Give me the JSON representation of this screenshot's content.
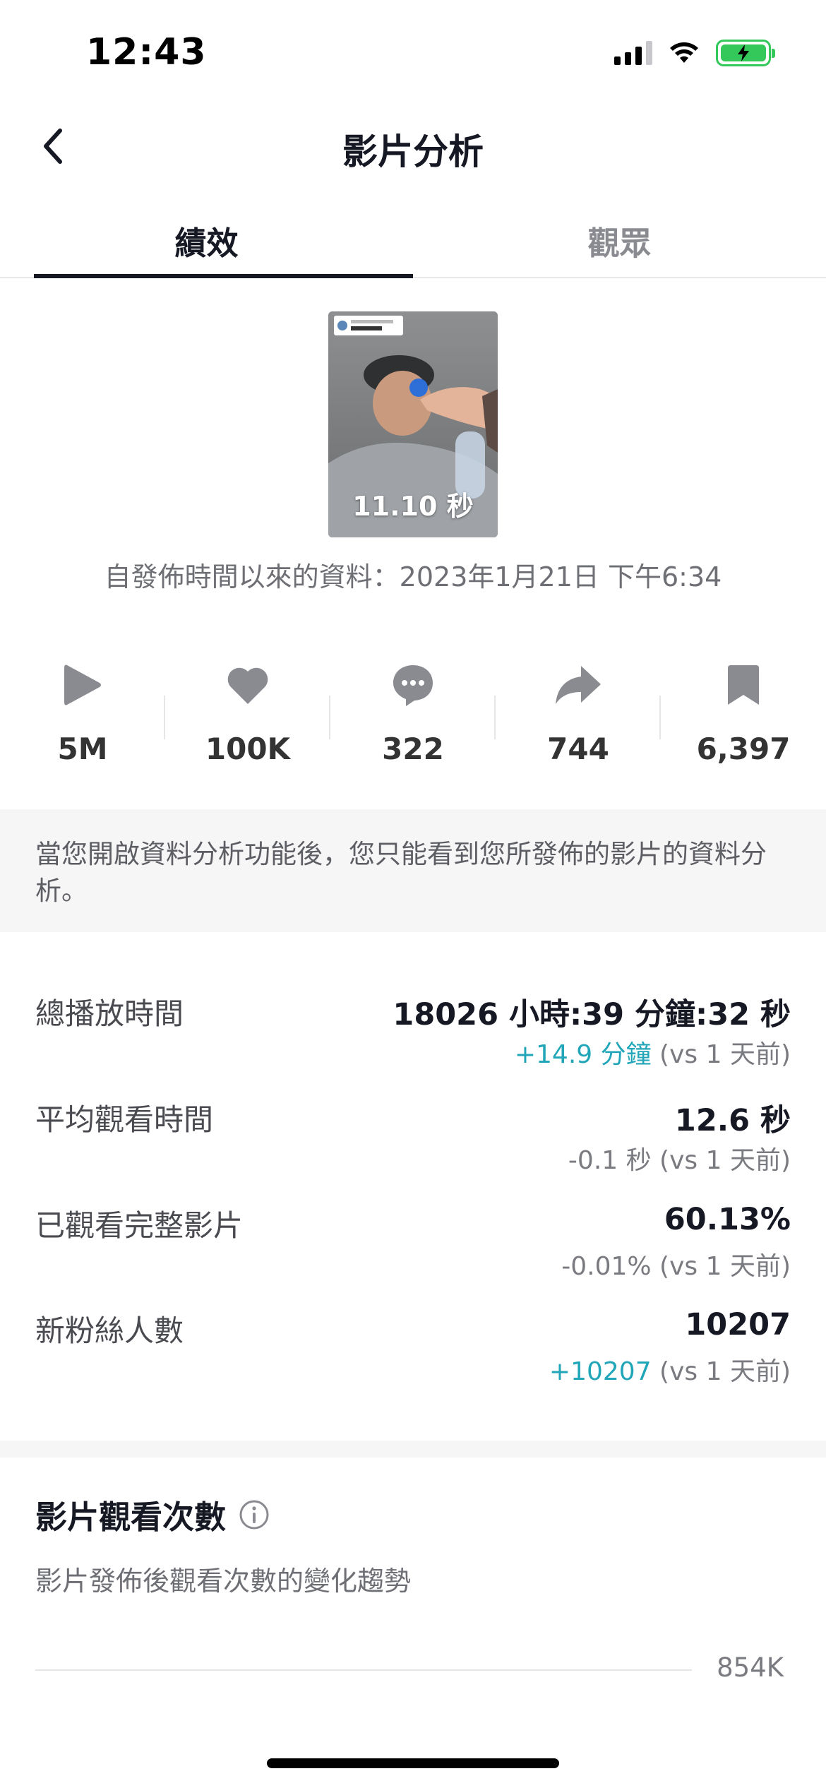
{
  "status_bar": {
    "time": "12:43",
    "icons": [
      "signal-icon",
      "wifi-icon",
      "battery-charging-icon"
    ]
  },
  "header": {
    "back_icon": "chevron-left-icon",
    "title": "影片分析"
  },
  "tabs": [
    {
      "label": "績效",
      "active": true
    },
    {
      "label": "觀眾",
      "active": false
    }
  ],
  "video": {
    "duration": "11.10 秒",
    "publish_info": "自發佈時間以來的資料：2023年1月21日 下午6:34"
  },
  "stats": [
    {
      "icon": "play-icon",
      "value": "5M"
    },
    {
      "icon": "heart-icon",
      "value": "100K"
    },
    {
      "icon": "comment-icon",
      "value": "322"
    },
    {
      "icon": "share-icon",
      "value": "744"
    },
    {
      "icon": "bookmark-icon",
      "value": "6,397"
    }
  ],
  "notice": "當您開啟資料分析功能後，您只能看到您所發佈的影片的資料分析。",
  "metrics": [
    {
      "label": "總播放時間",
      "value": "18026 小時:39 分鐘:32 秒",
      "change": "+14.9 分鐘",
      "change_suffix": " (vs 1 天前)"
    },
    {
      "label": "平均觀看時間",
      "value": "12.6 秒",
      "change": "-0.1 秒",
      "change_suffix": " (vs 1 天前)"
    },
    {
      "label": "已觀看完整影片",
      "value": "60.13%",
      "change": "-0.01%",
      "change_suffix": " (vs 1 天前)"
    },
    {
      "label": "新粉絲人數",
      "value": "10207",
      "change": "+10207",
      "change_suffix": " (vs 1 天前)"
    }
  ],
  "views_section": {
    "title": "影片觀看次數",
    "info_icon": "info-icon",
    "subtitle": "影片發佈後觀看次數的變化趨勢",
    "axis_tick": "854K"
  },
  "colors": {
    "accent_positive": "#20a6b8",
    "battery": "#34c759"
  }
}
